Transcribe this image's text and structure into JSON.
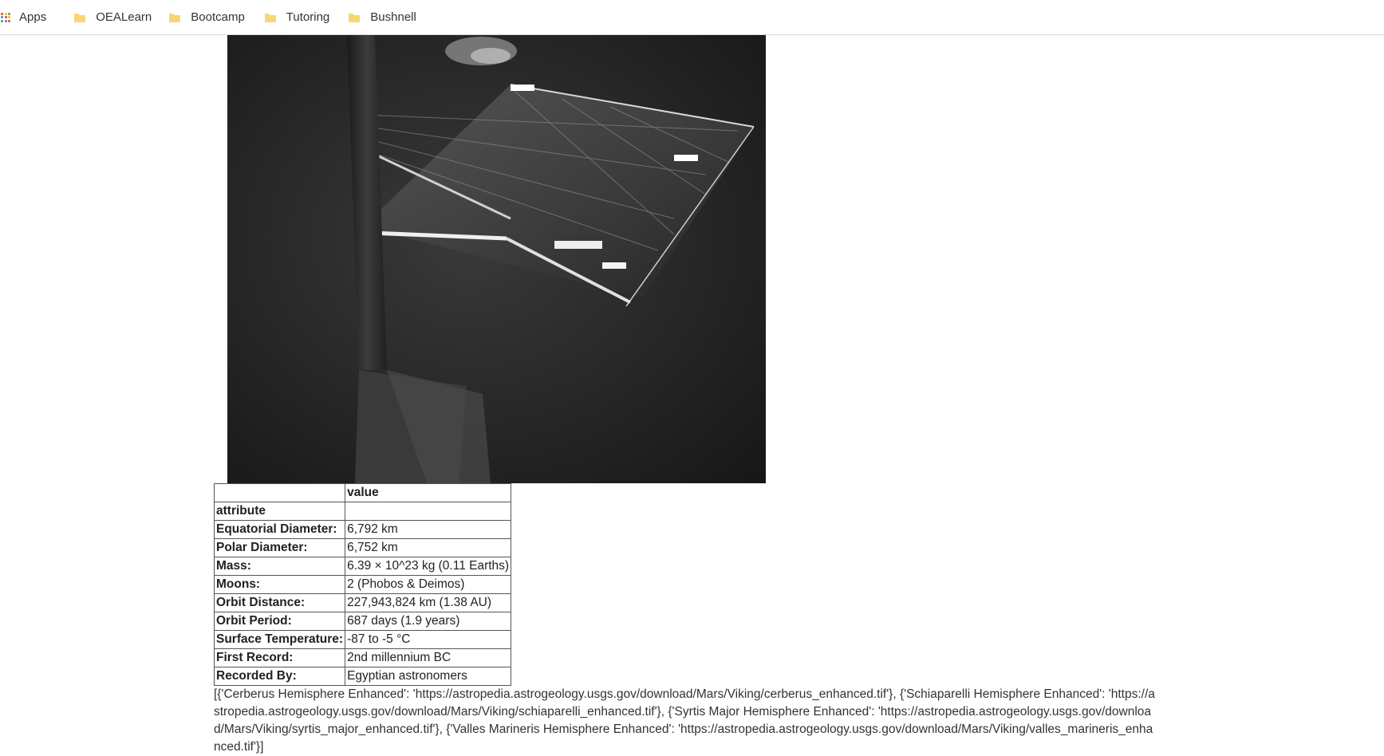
{
  "bookmarks": {
    "apps_label": "Apps",
    "folders": [
      "OEALearn",
      "Bootcamp",
      "Tutoring",
      "Bushnell"
    ],
    "folder_color": "#f7d774",
    "apps_colors": [
      "#ea4335",
      "#fbbc05",
      "#34a853",
      "#4285f4",
      "#ea4335",
      "#fbbc05",
      "#34a853",
      "#4285f4",
      "#ea4335"
    ]
  },
  "facts_table": {
    "header_value": "value",
    "index_label": "attribute",
    "rows": [
      {
        "attribute": "Equatorial Diameter:",
        "value": "6,792 km"
      },
      {
        "attribute": "Polar Diameter:",
        "value": "6,752 km"
      },
      {
        "attribute": "Mass:",
        "value": "6.39 × 10^23 kg (0.11 Earths)"
      },
      {
        "attribute": "Moons:",
        "value": "2 (Phobos & Deimos)"
      },
      {
        "attribute": "Orbit Distance:",
        "value": "227,943,824 km (1.38 AU)"
      },
      {
        "attribute": "Orbit Period:",
        "value": "687 days (1.9 years)"
      },
      {
        "attribute": "Surface Temperature:",
        "value": "-87 to -5 °C"
      },
      {
        "attribute": "First Record:",
        "value": "2nd millennium BC"
      },
      {
        "attribute": "Recorded By:",
        "value": "Egyptian astronomers"
      }
    ]
  },
  "hemispheres_text": "[{'Cerberus Hemisphere Enhanced': 'https://astropedia.astrogeology.usgs.gov/download/Mars/Viking/cerberus_enhanced.tif'}, {'Schiaparelli Hemisphere Enhanced': 'https://astropedia.astrogeology.usgs.gov/download/Mars/Viking/schiaparelli_enhanced.tif'}, {'Syrtis Major Hemisphere Enhanced': 'https://astropedia.astrogeology.usgs.gov/download/Mars/Viking/syrtis_major_enhanced.tif'}, {'Valles Marineris Hemisphere Enhanced': 'https://astropedia.astrogeology.usgs.gov/download/Mars/Viking/valles_marineris_enhanced.tif'}]"
}
